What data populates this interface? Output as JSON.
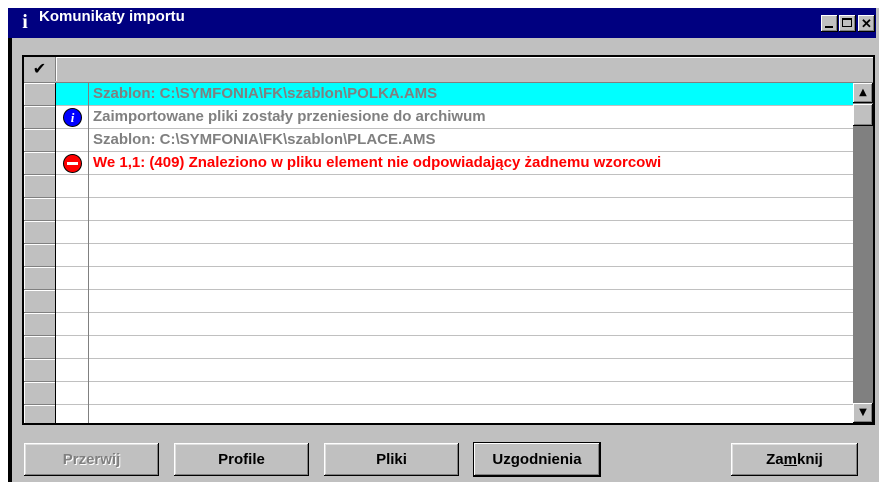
{
  "window": {
    "title": "Komunikaty importu",
    "title_icon": "info-glyph",
    "controls": [
      "minimize",
      "maximize",
      "close"
    ]
  },
  "grid": {
    "header_icon": "✔",
    "rows": [
      {
        "icon": "",
        "text": "Szablon: C:\\SYMFONIA\\FK\\szablon\\POLKA.AMS",
        "style": "gray",
        "selected": true
      },
      {
        "icon": "info",
        "text": "Zaimportowane pliki zostały przeniesione do archiwum",
        "style": "gray",
        "selected": false
      },
      {
        "icon": "",
        "text": "Szablon: C:\\SYMFONIA\\FK\\szablon\\PLACE.AMS",
        "style": "gray",
        "selected": false
      },
      {
        "icon": "error",
        "text": "We 1,1: (409) Znaleziono w pliku element nie odpowiadający żadnemu wzorcowi",
        "style": "red",
        "selected": false
      },
      {
        "icon": "",
        "text": "",
        "style": "",
        "selected": false
      },
      {
        "icon": "",
        "text": "",
        "style": "",
        "selected": false
      },
      {
        "icon": "",
        "text": "",
        "style": "",
        "selected": false
      },
      {
        "icon": "",
        "text": "",
        "style": "",
        "selected": false
      },
      {
        "icon": "",
        "text": "",
        "style": "",
        "selected": false
      },
      {
        "icon": "",
        "text": "",
        "style": "",
        "selected": false
      },
      {
        "icon": "",
        "text": "",
        "style": "",
        "selected": false
      },
      {
        "icon": "",
        "text": "",
        "style": "",
        "selected": false
      },
      {
        "icon": "",
        "text": "",
        "style": "",
        "selected": false
      },
      {
        "icon": "",
        "text": "",
        "style": "",
        "selected": false
      },
      {
        "icon": "",
        "text": "",
        "style": "",
        "selected": false
      }
    ]
  },
  "buttons": {
    "przerwij": "Przerwij",
    "profile": "Profile",
    "pliki": "Pliki",
    "uzgodnienia": "Uzgodnienia",
    "zamknij_pre": "Za",
    "zamknij_mnemonic": "m",
    "zamknij_post": "knij"
  },
  "colors": {
    "titlebar": "#000080",
    "selection": "#00ffff",
    "error_text": "#ff0000",
    "info_text": "#808080"
  }
}
